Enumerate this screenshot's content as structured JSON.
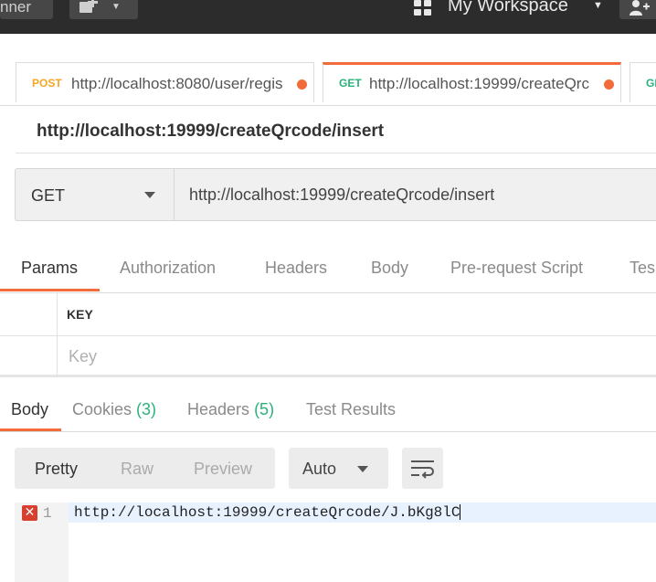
{
  "topbar": {
    "runner_label": "nner",
    "new_icon": "plus-box-icon",
    "workspace_label": "My Workspace",
    "workspace_icon": "grid-icon",
    "invite_icon": "add-user-icon"
  },
  "tabs": [
    {
      "method": "POST",
      "url": "http://localhost:8080/user/regis",
      "method_color": "#f5a623"
    },
    {
      "method": "GET",
      "url": "http://localhost:19999/createQrc",
      "method_color": "#2ab27b"
    },
    {
      "method": "GE",
      "url": "",
      "method_color": "#2ab27b"
    }
  ],
  "request": {
    "title": "http://localhost:19999/createQrcode/insert",
    "method": "GET",
    "url": "http://localhost:19999/createQrcode/insert"
  },
  "request_tabs": [
    "Params",
    "Authorization",
    "Headers",
    "Body",
    "Pre-request Script",
    "Tes"
  ],
  "params": {
    "key_header": "KEY",
    "key_placeholder": "Key"
  },
  "response_tabs": {
    "body": "Body",
    "cookies": "Cookies",
    "cookies_count": "(3)",
    "headers": "Headers",
    "headers_count": "(5)",
    "tests": "Test Results"
  },
  "formats": [
    "Pretty",
    "Raw",
    "Preview"
  ],
  "format_mode": "Auto",
  "editor": {
    "line_number": "1",
    "error_mark": "✕",
    "content": "http://localhost:19999/createQrcode/J.bKg8lC"
  },
  "colors": {
    "accent": "#f26b3a",
    "success": "#2ab27b",
    "warning": "#f5a623",
    "error": "#d7402f"
  }
}
